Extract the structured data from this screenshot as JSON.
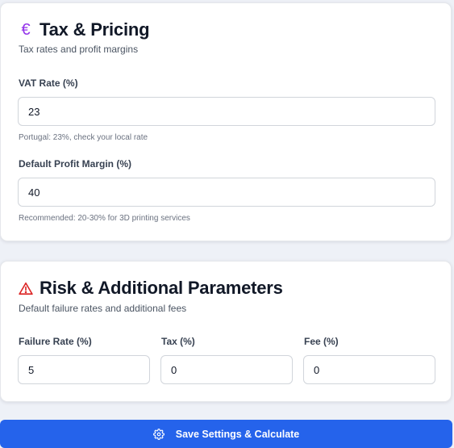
{
  "tax_pricing": {
    "icon": "euro-icon",
    "icon_glyph": "€",
    "title": "Tax & Pricing",
    "subtitle": "Tax rates and profit margins",
    "vat_rate": {
      "label": "VAT Rate (%)",
      "value": "23",
      "hint": "Portugal: 23%, check your local rate"
    },
    "profit_margin": {
      "label": "Default Profit Margin (%)",
      "value": "40",
      "hint": "Recommended: 20-30% for 3D printing services"
    }
  },
  "risk": {
    "icon": "warning-triangle-icon",
    "title": "Risk & Additional Parameters",
    "subtitle": "Default failure rates and additional fees",
    "failure_rate": {
      "label": "Failure Rate (%)",
      "value": "5"
    },
    "tax": {
      "label": "Tax (%)",
      "value": "0"
    },
    "fee": {
      "label": "Fee (%)",
      "value": "0"
    }
  },
  "save_button": {
    "icon": "gear-icon",
    "label": "Save Settings & Calculate"
  },
  "colors": {
    "accent": "#2563eb",
    "euro_icon": "#9333ea",
    "warning_icon": "#dc2626",
    "background": "#eef1f7"
  }
}
